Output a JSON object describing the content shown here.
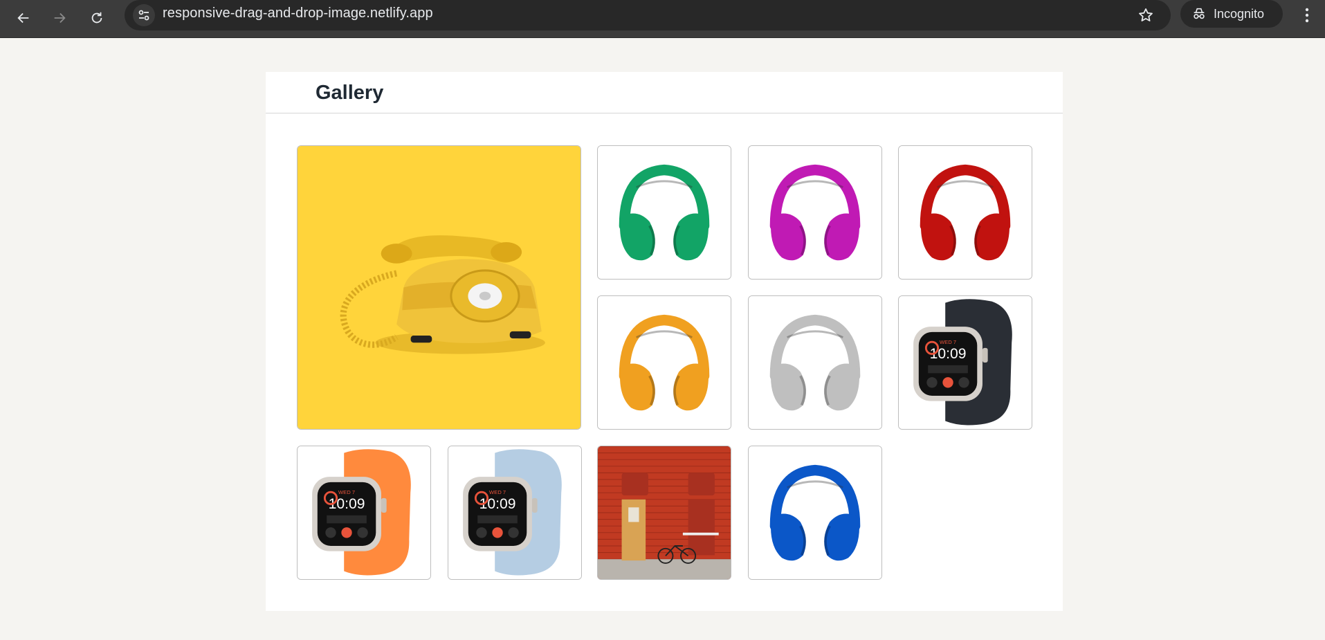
{
  "browser": {
    "url": "responsive-drag-and-drop-image.netlify.app",
    "profile_label": "Incognito",
    "icons": {
      "back": "arrow-left-icon",
      "forward": "arrow-right-icon",
      "reload": "reload-icon",
      "site_info": "tune-icon",
      "bookmark": "star-icon",
      "incognito": "incognito-icon",
      "menu": "more-vertical-icon"
    }
  },
  "page": {
    "title": "Gallery",
    "images": [
      {
        "subject": "yellow rotary telephone",
        "bg": "#ffd43b",
        "featured": true
      },
      {
        "subject": "green headphones",
        "color": "#12a466"
      },
      {
        "subject": "magenta headphones",
        "color": "#c01ab4"
      },
      {
        "subject": "red headphones",
        "color": "#c1120f"
      },
      {
        "subject": "orange headphones",
        "color": "#f0a020"
      },
      {
        "subject": "silver headphones",
        "color": "#bfbfbf"
      },
      {
        "subject": "smartwatch black band",
        "color": "#2a2e35"
      },
      {
        "subject": "smartwatch orange band",
        "color": "#ff8a3d"
      },
      {
        "subject": "smartwatch light blue band",
        "color": "#b5cde3"
      },
      {
        "subject": "red brick wall with door and bicycle",
        "color": "#b8341f"
      },
      {
        "subject": "blue headphones",
        "color": "#0b57c8"
      }
    ],
    "watch_time": "10:09",
    "watch_day": "WED 7"
  }
}
